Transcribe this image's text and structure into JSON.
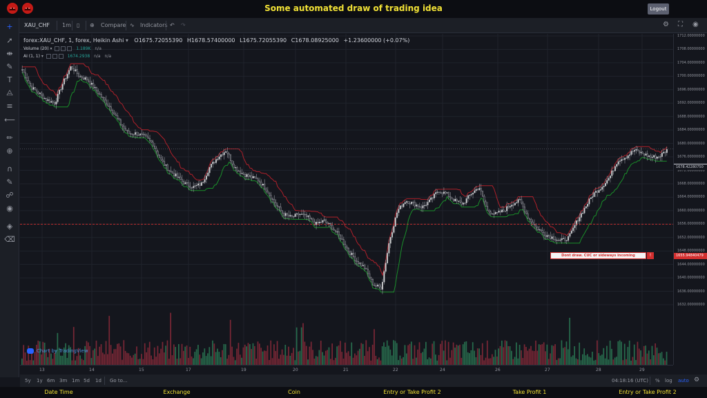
{
  "header": {
    "title": "Some automated draw of trading idea",
    "logout_label": "Logout"
  },
  "toolbar": {
    "symbol": "XAU_CHF",
    "interval": "1m",
    "compare_label": "Compare",
    "indicators_label": "Indicators"
  },
  "legend": {
    "main": "forex:XAU_CHF, 1, forex, Heikin Ashi",
    "open": "O1675.72055390",
    "high": "H1678.57400000",
    "low": "L1675.72055390",
    "close": "C1678.08925000",
    "change": "+1.23600000 (+0.07%)",
    "volume_label": "Volume (20)",
    "volume_value": "1.189K",
    "volume_na": "n/a",
    "ai_label": "AI (1, 1)",
    "ai_value": "1674.2938",
    "ai_na1": "n/a",
    "ai_na2": "n/a"
  },
  "watermark": "Chart by TradingView",
  "annotation": {
    "text": "Dont draw. CUC or sideways incoming",
    "marker": "!",
    "price_label": "1655.94840479"
  },
  "price_axis": {
    "ticks": [
      "1712.00000000",
      "1708.00000000",
      "1704.00000000",
      "1700.00000000",
      "1696.00000000",
      "1692.00000000",
      "1688.00000000",
      "1684.00000000",
      "1680.00000000",
      "1676.00000000",
      "1672.00000000",
      "1668.00000000",
      "1664.00000000",
      "1660.00000000",
      "1656.00000000",
      "1652.00000000",
      "1648.00000000",
      "1644.00000000",
      "1640.00000000",
      "1636.00000000",
      "1632.00000000"
    ],
    "current_price": "1678.42280750"
  },
  "time_axis": {
    "ticks": [
      "13",
      "14",
      "15",
      "17",
      "19",
      "20",
      "21",
      "22",
      "24",
      "26",
      "27",
      "28",
      "29"
    ]
  },
  "bottom_bar": {
    "ranges": [
      "5y",
      "1y",
      "6m",
      "3m",
      "1m",
      "5d",
      "1d"
    ],
    "goto_label": "Go to...",
    "clock": "04:18:16 (UTC)",
    "percent_label": "%",
    "log_label": "log",
    "auto_label": "auto"
  },
  "footer": {
    "columns": [
      "Date Time",
      "Exchange",
      "Coin",
      "Entry or Take Profit 2",
      "Take Profit 1",
      "Entry or Take Profit 2"
    ]
  },
  "colors": {
    "up": "#d6d6d6",
    "down": "#26282f",
    "ma_red": "#b0202a",
    "ma_green": "#1a8f2a",
    "vol_up": "#2a7a55",
    "vol_down": "#8a2a3a",
    "accent_blue": "#2962ff",
    "title_yellow": "#f2e236"
  },
  "chart_data": {
    "type": "candlestick",
    "ylim": [
      1630,
      1713
    ],
    "series": [
      {
        "name": "forex:XAU_CHF, 1, forex, Heikin Ashi",
        "values": [
          1702,
          1697,
          1695,
          1693,
          1692,
          1698,
          1703,
          1700,
          1699,
          1696,
          1693,
          1690,
          1686,
          1683,
          1683,
          1682,
          1680,
          1675,
          1672,
          1670,
          1668,
          1667,
          1668,
          1673,
          1676,
          1678,
          1673,
          1671,
          1670,
          1669,
          1666,
          1662,
          1659,
          1658,
          1659,
          1658,
          1656,
          1657,
          1655,
          1652,
          1648,
          1645,
          1643,
          1638,
          1637,
          1651,
          1660,
          1663,
          1662,
          1661,
          1663,
          1666,
          1665,
          1663,
          1662,
          1665,
          1667,
          1660,
          1659,
          1660,
          1662,
          1663,
          1658,
          1655,
          1653,
          1652,
          1651,
          1652,
          1657,
          1661,
          1665,
          1667,
          1670,
          1675,
          1676,
          1678,
          1677,
          1676,
          1676,
          1678
        ]
      }
    ]
  }
}
